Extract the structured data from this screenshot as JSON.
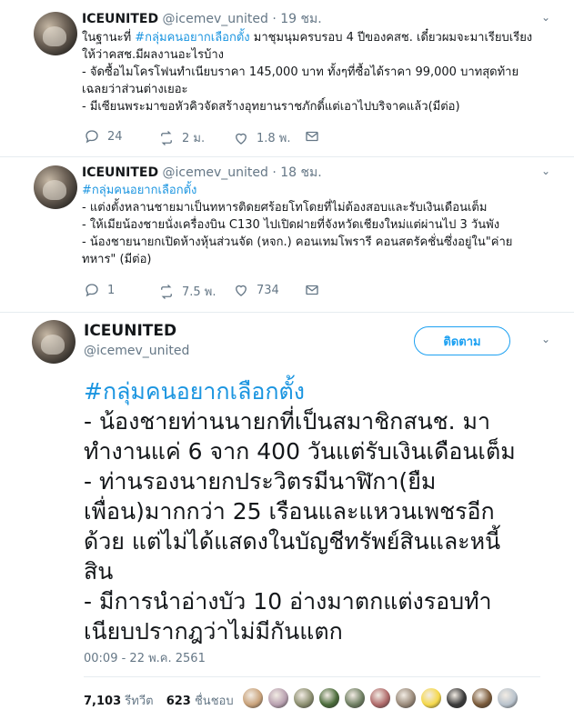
{
  "tweets": [
    {
      "name": "ICEUNITED",
      "handle": "@icemev_united",
      "sep": "·",
      "time": "19 ชม.",
      "lines": [
        {
          "pre": "ในฐานะที่ ",
          "tag": "#กลุ่มคนอยากเลือกตั้ง",
          "post": " มาชุมนุมครบรอบ 4 ปีของคสช. เดี๋ยวผมจะมาเรียบเรียง"
        },
        {
          "pre": "ให้ว่าคสช.มีผลงานอะไรบ้าง",
          "tag": "",
          "post": ""
        },
        {
          "pre": "- จัดซื้อไมโครโฟนทำเนียบราคา 145,000 บาท ทั้งๆที่ซื้อได้ราคา 99,000 บาทสุดท้าย",
          "tag": "",
          "post": ""
        },
        {
          "pre": "เฉลยว่าส่วนต่างเยอะ",
          "tag": "",
          "post": ""
        },
        {
          "pre": "- มีเซียนพระมาขอหัวคิวจัดสร้างอุทยานราชภักดิ์แต่เอาไปบริจาคแล้ว(มีต่อ)",
          "tag": "",
          "post": ""
        }
      ],
      "replies": "24",
      "retweets": "2 ม.",
      "likes": "1.8 พ."
    },
    {
      "name": "ICEUNITED",
      "handle": "@icemev_united",
      "sep": "·",
      "time": "18 ชม.",
      "lines": [
        {
          "pre": "",
          "tag": "#กลุ่มคนอยากเลือกตั้ง",
          "post": ""
        },
        {
          "pre": "- แต่งตั้งหลานชายมาเป็นทหารติดยศร้อยโทโดยที่ไม่ต้องสอบและรับเงินเดือนเต็ม",
          "tag": "",
          "post": ""
        },
        {
          "pre": "- ให้เมียน้องชายนั่งเครื่องบิน C130 ไปเปิดฝายที่จังหวัดเชียงใหม่แต่ผ่านไป 3 วันพัง",
          "tag": "",
          "post": ""
        },
        {
          "pre": "- น้องชายนายกเปิดห้างหุ้นส่วนจัด (หจก.) คอนเทมโพรารี คอนสตรัคชั่นซึ่งอยู่ใน\"ค่าย",
          "tag": "",
          "post": ""
        },
        {
          "pre": "ทหาร\" (มีต่อ)",
          "tag": "",
          "post": ""
        }
      ],
      "replies": "1",
      "retweets": "7.5 พ.",
      "likes": "734"
    }
  ],
  "main": {
    "name": "ICEUNITED",
    "handle": "@icemev_united",
    "follow_label": "ติดตาม",
    "lines": [
      {
        "pre": "",
        "tag": "#กลุ่มคนอยากเลือกตั้ง",
        "post": ""
      },
      {
        "pre": "- น้องชายท่านนายกที่เป็นสมาชิกสนช. มา",
        "tag": "",
        "post": ""
      },
      {
        "pre": "ทำงานแค่ 6 จาก 400 วันแต่รับเงินเดือนเต็ม",
        "tag": "",
        "post": ""
      },
      {
        "pre": "- ท่านรองนายกประวิตรมีนาฬิกา(ยืม",
        "tag": "",
        "post": ""
      },
      {
        "pre": "เพื่อน)มากกว่า 25 เรือนและแหวนเพชรอีก",
        "tag": "",
        "post": ""
      },
      {
        "pre": "ด้วย แต่ไม่ได้แสดงในบัญชีทรัพย์สินและหนี้",
        "tag": "",
        "post": ""
      },
      {
        "pre": "สิน",
        "tag": "",
        "post": ""
      },
      {
        "pre": "- มีการนำอ่างบัว 10 อ่างมาตกแต่งรอบทำ",
        "tag": "",
        "post": ""
      },
      {
        "pre": "เนียบปรากฎว่าไม่มีกันแตก",
        "tag": "",
        "post": ""
      }
    ],
    "timestamp": "00:09 - 22 พ.ค. 2561",
    "retweets_count": "7,103",
    "retweets_label": "รีทวีต",
    "likes_count": "623",
    "likes_label": "ชื่นชอบ",
    "liker_colors": [
      "#c9a27a",
      "#b8a0b0",
      "#8c8f70",
      "#4a6b3a",
      "#6f7f62",
      "#b06a6a",
      "#9a8a7a",
      "#f5d84a",
      "#3a3a3a",
      "#7a5a3a",
      "#b8c2cc"
    ]
  },
  "colors": {
    "hashtag": "#1b95e0",
    "accent": "#1da1f2",
    "muted": "#657786"
  }
}
